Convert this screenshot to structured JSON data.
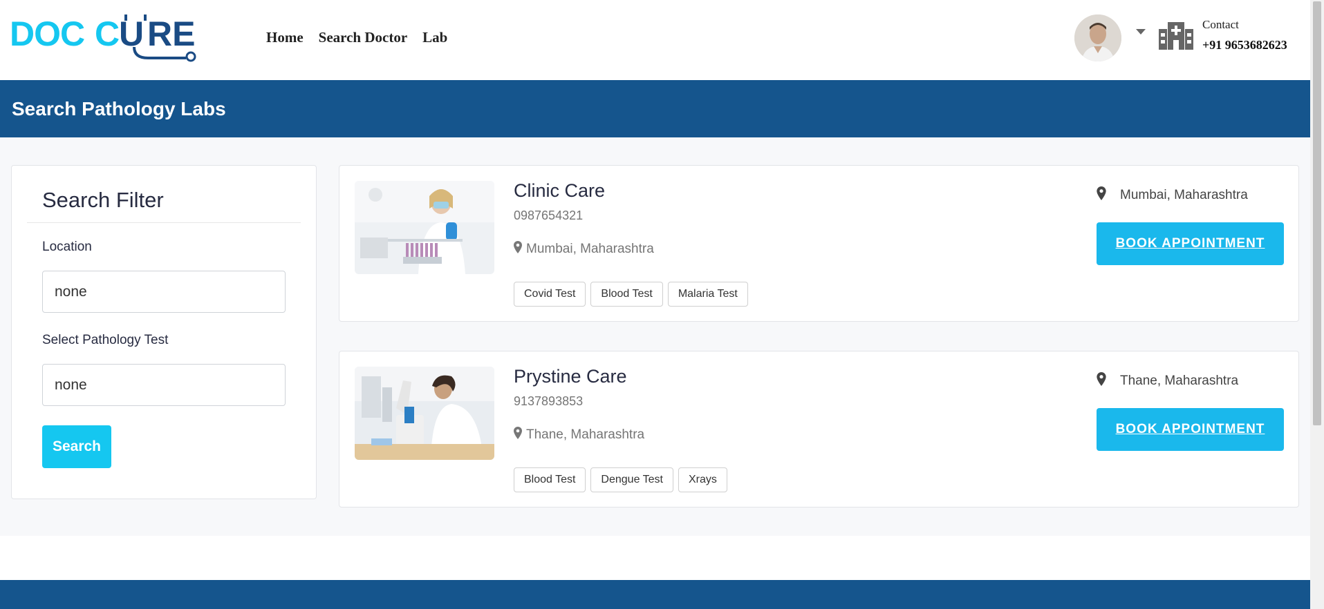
{
  "header": {
    "logo_text": "DOCCURE",
    "nav": [
      "Home",
      "Search Doctor",
      "Lab"
    ],
    "contact_label": "Contact",
    "contact_phone": "+91 9653682623"
  },
  "banner": {
    "title": "Search Pathology Labs"
  },
  "filter": {
    "title": "Search Filter",
    "location_label": "Location",
    "location_value": "none",
    "test_label": "Select Pathology Test",
    "test_value": "none",
    "search_label": "Search"
  },
  "labs": [
    {
      "name": "Clinic Care",
      "phone": "0987654321",
      "location": "Mumbai, Maharashtra",
      "tags": [
        "Covid Test",
        "Blood Test",
        "Malaria Test"
      ],
      "right_location": "Mumbai, Maharashtra",
      "book_label": "BOOK APPOINTMENT"
    },
    {
      "name": "Prystine Care",
      "phone": "9137893853",
      "location": "Thane, Maharashtra",
      "tags": [
        "Blood Test",
        "Dengue Test",
        "Xrays"
      ],
      "right_location": "Thane, Maharashtra",
      "book_label": "BOOK APPOINTMENT"
    }
  ],
  "colors": {
    "brand_blue": "#15558d",
    "logo_cyan": "#15c7f0",
    "logo_navy": "#1a4b84",
    "book_button": "#1ab8ec"
  },
  "icons": [
    "stethoscope-logo-icon",
    "chevron-down-icon",
    "hospital-icon",
    "map-pin-icon"
  ]
}
